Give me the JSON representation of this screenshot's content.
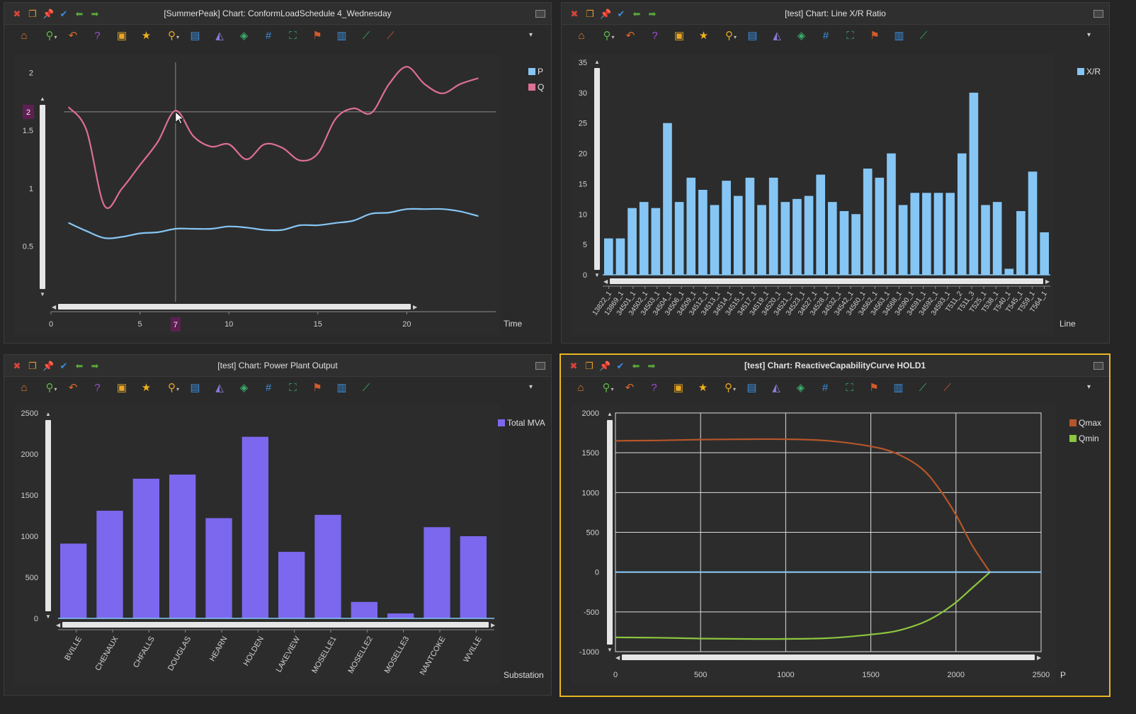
{
  "panels": {
    "load": {
      "title": "[SummerPeak] Chart: ConformLoadSchedule 4_Wednesday",
      "xaxis_name": "Time",
      "cursor_x_label": "7",
      "cursor_y_label": "2",
      "legend": [
        {
          "name": "P",
          "color": "#86c6f4"
        },
        {
          "name": "Q",
          "color": "#de6f95"
        }
      ]
    },
    "xr": {
      "title": "[test] Chart: Line X/R Ratio",
      "xaxis_name": "Line",
      "legend": [
        {
          "name": "X/R",
          "color": "#86c6f4"
        }
      ]
    },
    "plant": {
      "title": "[test] Chart: Power Plant Output",
      "xaxis_name": "Substation",
      "legend": [
        {
          "name": "Total MVA",
          "color": "#7b68ee"
        }
      ]
    },
    "reactive": {
      "title": "[test] Chart: ReactiveCapabilityCurve HOLD1",
      "xaxis_name": "P",
      "legend": [
        {
          "name": "Qmax",
          "color": "#b5562a"
        },
        {
          "name": "Qmin",
          "color": "#8cc63f"
        }
      ]
    }
  },
  "icons": {
    "titlebar": [
      {
        "name": "close-icon",
        "glyph": "✖",
        "color": "#d9453c"
      },
      {
        "name": "float-window-icon",
        "glyph": "❐",
        "color": "#e39a2b"
      },
      {
        "name": "pin-icon",
        "glyph": "📌",
        "color": "#e39a2b"
      },
      {
        "name": "check-icon",
        "glyph": "✔",
        "color": "#3b8fe0"
      },
      {
        "name": "back-arrow-icon",
        "glyph": "⬅",
        "color": "#5aa83c"
      },
      {
        "name": "forward-arrow-icon",
        "glyph": "➡",
        "color": "#5aa83c"
      }
    ],
    "toolbar": [
      {
        "name": "home-icon",
        "glyph": "⌂",
        "color": "#e07b2c"
      },
      {
        "name": "zoom-icon",
        "glyph": "⚲",
        "color": "#5db548",
        "dropdown": true
      },
      {
        "name": "undo-icon",
        "glyph": "↶",
        "color": "#e0692c"
      },
      {
        "name": "help-icon",
        "glyph": "?",
        "color": "#a44ad4"
      },
      {
        "name": "star-box-icon",
        "glyph": "▣",
        "color": "#e8a624"
      },
      {
        "name": "favorite-star-icon",
        "glyph": "★",
        "color": "#f0b01c"
      },
      {
        "name": "search-icon",
        "glyph": "⚲",
        "color": "#e8a624",
        "dropdown": true
      },
      {
        "name": "data-table-icon",
        "glyph": "▤",
        "color": "#3b8fe0"
      },
      {
        "name": "area-chart-icon",
        "glyph": "◭",
        "color": "#8a7ad8"
      },
      {
        "name": "tag-icon",
        "glyph": "◈",
        "color": "#3ab06a"
      },
      {
        "name": "grid-icon",
        "glyph": "#",
        "color": "#3b8fe0"
      },
      {
        "name": "fit-view-icon",
        "glyph": "⛶",
        "color": "#3ab06a"
      },
      {
        "name": "marker-pin-icon",
        "glyph": "⚑",
        "color": "#d05a2c"
      },
      {
        "name": "bar-chart-icon",
        "glyph": "▥",
        "color": "#3b8fe0"
      },
      {
        "name": "line-chart-icon",
        "glyph": "⟋",
        "color": "#3ab06a"
      },
      {
        "name": "trend-chart-icon",
        "glyph": "⟋",
        "color": "#d05a2c"
      }
    ],
    "toolbar_more": "▾"
  },
  "chart_data": [
    {
      "type": "line",
      "panel": "ConformLoadSchedule 4_Wednesday",
      "xlabel": "Time",
      "xlim": [
        0,
        25
      ],
      "ylim": [
        0.05,
        2.1
      ],
      "xticks": [
        0,
        5,
        10,
        15,
        20
      ],
      "yticks": [
        0.5,
        1,
        1.5,
        2
      ],
      "cursor": {
        "x": 7,
        "y": 1.66
      },
      "series": [
        {
          "name": "P",
          "color": "#86c6f4",
          "x": [
            1,
            2,
            3,
            4,
            5,
            6,
            7,
            8,
            9,
            10,
            11,
            12,
            13,
            14,
            15,
            16,
            17,
            18,
            19,
            20,
            21,
            22,
            23,
            24
          ],
          "y": [
            0.7,
            0.63,
            0.57,
            0.58,
            0.61,
            0.62,
            0.65,
            0.65,
            0.65,
            0.67,
            0.66,
            0.64,
            0.64,
            0.68,
            0.68,
            0.7,
            0.72,
            0.78,
            0.79,
            0.82,
            0.82,
            0.82,
            0.8,
            0.76
          ]
        },
        {
          "name": "Q",
          "color": "#de6f95",
          "x": [
            1,
            2,
            3,
            4,
            5,
            6,
            7,
            8,
            9,
            10,
            11,
            12,
            13,
            14,
            15,
            16,
            17,
            18,
            19,
            20,
            21,
            22,
            23,
            24
          ],
          "y": [
            1.7,
            1.5,
            0.85,
            1.0,
            1.2,
            1.4,
            1.67,
            1.45,
            1.36,
            1.38,
            1.25,
            1.38,
            1.35,
            1.24,
            1.3,
            1.6,
            1.69,
            1.65,
            1.9,
            2.05,
            1.9,
            1.82,
            1.9,
            1.95
          ]
        }
      ]
    },
    {
      "type": "bar",
      "panel": "Line X/R Ratio",
      "xlabel": "Line",
      "ylim": [
        0,
        35
      ],
      "yticks": [
        0,
        5,
        10,
        15,
        20,
        25,
        30,
        35
      ],
      "categories": [
        "13822_1",
        "13869_1",
        "34501_1",
        "34502_1",
        "34503_1",
        "34504_1",
        "34506_1",
        "34509_1",
        "34512_1",
        "34513_1",
        "34514_1",
        "34515_1",
        "34517_1",
        "34519_1",
        "34520_1",
        "34521_1",
        "34523_1",
        "34527_1",
        "34528_1",
        "34532_1",
        "34542_1",
        "34560_1",
        "34562_1",
        "34563_1",
        "34568_1",
        "34590_1",
        "34591_1",
        "34592_1",
        "34593_1",
        "T511_2",
        "T511_3",
        "T525_1",
        "T538_1",
        "T540_1",
        "T545_1",
        "T559_1",
        "T564_1"
      ],
      "series": [
        {
          "name": "X/R",
          "color": "#86c6f4",
          "values": [
            6,
            6,
            11,
            12,
            11,
            25,
            12,
            16,
            14,
            11.5,
            15.5,
            13,
            16,
            11.5,
            16,
            12,
            12.5,
            13,
            16.5,
            12,
            10.5,
            10,
            17.5,
            16,
            20,
            11.5,
            13.5,
            13.5,
            13.5,
            13.5,
            20,
            30,
            11.5,
            12,
            1,
            10.5,
            17,
            7
          ]
        }
      ]
    },
    {
      "type": "bar",
      "panel": "Power Plant Output",
      "xlabel": "Substation",
      "ylim": [
        0,
        2500
      ],
      "yticks": [
        0,
        500,
        1000,
        1500,
        2000,
        2500
      ],
      "categories": [
        "BVILLE",
        "CHENAUX",
        "CHFALLS",
        "DOUGLAS",
        "HEARN",
        "HOLDEN",
        "LAKEVIEW",
        "MOSELLE1",
        "MOSELLE2",
        "MOSELLE3",
        "NANTCOKE",
        "WVILLE"
      ],
      "series": [
        {
          "name": "Total MVA",
          "color": "#7b68ee",
          "values": [
            910,
            1310,
            1700,
            1750,
            1220,
            2210,
            810,
            1260,
            200,
            60,
            1110,
            1000
          ]
        }
      ]
    },
    {
      "type": "line",
      "panel": "ReactiveCapabilityCurve HOLD1",
      "xlabel": "P",
      "xlim": [
        0,
        2500
      ],
      "ylim": [
        -1000,
        2000
      ],
      "xticks": [
        0,
        500,
        1000,
        1500,
        2000,
        2500
      ],
      "yticks": [
        -1000,
        -500,
        0,
        500,
        1000,
        1500,
        2000
      ],
      "grid": true,
      "series": [
        {
          "name": "Qmax",
          "color": "#b5562a",
          "x": [
            0,
            250,
            500,
            750,
            1000,
            1250,
            1500,
            1650,
            1800,
            1900,
            2000,
            2100,
            2200
          ],
          "y": [
            1650,
            1655,
            1665,
            1670,
            1670,
            1650,
            1580,
            1490,
            1300,
            1050,
            720,
            320,
            0
          ]
        },
        {
          "name": "Qmin",
          "color": "#8cc63f",
          "x": [
            0,
            250,
            500,
            750,
            1000,
            1250,
            1500,
            1650,
            1800,
            1900,
            2000,
            2100,
            2200
          ],
          "y": [
            -820,
            -825,
            -835,
            -840,
            -840,
            -830,
            -785,
            -740,
            -640,
            -530,
            -380,
            -190,
            0
          ]
        },
        {
          "name": "",
          "color": "#86c6f4",
          "x": [
            0,
            2500
          ],
          "y": [
            0,
            0
          ]
        }
      ]
    }
  ]
}
